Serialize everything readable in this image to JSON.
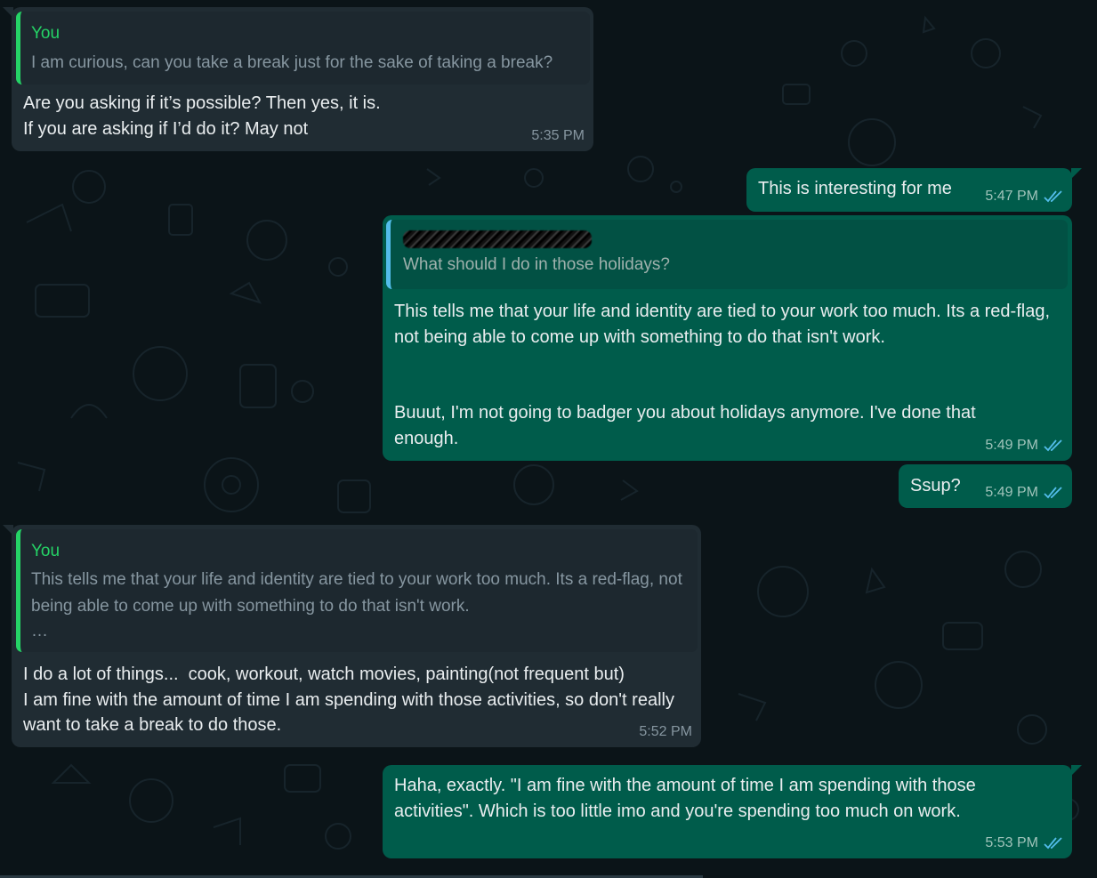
{
  "colors": {
    "background": "#0b1418",
    "incoming_bubble": "#202c33",
    "outgoing_bubble": "#005c4b",
    "quote_author": "#25d366",
    "quote_bar_outgoing": "#53bdeb",
    "read_ticks": "#53bdeb"
  },
  "messages": [
    {
      "direction": "incoming",
      "quote": {
        "author": "You",
        "text": "I am curious, can you take a break just for the sake of taking a break?"
      },
      "text": "Are you asking if it’s possible? Then yes, it is.\nIf you are asking if I’d do it? May not",
      "time": "5:35 PM"
    },
    {
      "direction": "outgoing",
      "text": "This is interesting for me",
      "time": "5:47 PM",
      "status_icon": "double-check-read-icon"
    },
    {
      "direction": "outgoing",
      "quote": {
        "author_redacted": true,
        "text": "What should I do in those holidays?"
      },
      "text_part1": "This tells me that your life and identity are tied to your work too much. Its a red-flag, not being able to come up with something to do that isn't work.",
      "text_part2": "Buuut, I'm not going to badger you about holidays anymore. I've done that enough.",
      "time": "5:49 PM",
      "status_icon": "double-check-read-icon"
    },
    {
      "direction": "outgoing",
      "text": "Ssup?",
      "time": "5:49 PM",
      "status_icon": "double-check-read-icon"
    },
    {
      "direction": "incoming",
      "quote": {
        "author": "You",
        "text": "This tells me that your life and identity are tied to your work too much. Its a red-flag, not being able to come up with something to do that isn't work.",
        "ellipsis": "…"
      },
      "text": "I do a lot of things...  cook, workout, watch movies, painting(not frequent but)\nI am fine with the amount of time I am spending with those activities, so don't really want to take a break to do those.",
      "time": "5:52 PM"
    },
    {
      "direction": "outgoing",
      "text": "Haha, exactly. \"I am fine with the amount of time I am spending with those activities\". Which is too little imo and you're spending too much on work.",
      "time": "5:53 PM",
      "status_icon": "double-check-read-icon"
    }
  ]
}
